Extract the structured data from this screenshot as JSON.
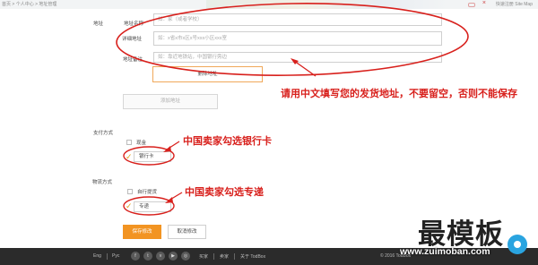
{
  "topbar": {
    "breadcrumb": "首页 > 个人中心 > 地址管理",
    "right_text": "快速注册  Site Map"
  },
  "address": {
    "section_label": "地址",
    "name_label": "地址名称",
    "name_placeholder": "如：家（或者学校）",
    "detail_label": "详细地址",
    "detail_placeholder": "如：x省x市x区x号xxx小区xxx室",
    "note_label": "地址备注",
    "note_placeholder": "如：靠近地铁站，中国银行旁边",
    "delete_button": "删除地址",
    "add_button": "添加地址"
  },
  "payment": {
    "section_label": "支付方式",
    "options": [
      {
        "label": "现金",
        "checked": false
      },
      {
        "label": "银行卡",
        "checked": true
      }
    ]
  },
  "delivery": {
    "section_label": "物流方式",
    "options": [
      {
        "label": "自行提货",
        "checked": false
      },
      {
        "label": "专递",
        "checked": true
      }
    ]
  },
  "actions": {
    "save": "保存修改",
    "cancel": "取消修改"
  },
  "annotations": {
    "address_note": "请用中文填写您的发货地址，不要留空，否则不能保存",
    "bank_note": "中国卖家勾选银行卡",
    "express_note": "中国卖家勾选专递"
  },
  "footer": {
    "lang1": "Eng",
    "lang2": "Pyc",
    "links": [
      "买家",
      "卖家",
      "关于 TodBox"
    ],
    "copyright": "© 2016 TodBox"
  },
  "watermark": {
    "title": "最模板",
    "url": "www.zuimoban.com"
  },
  "colors": {
    "accent": "#f29422",
    "annotation": "#d8201c",
    "footer_bg": "#2b2b2b"
  }
}
